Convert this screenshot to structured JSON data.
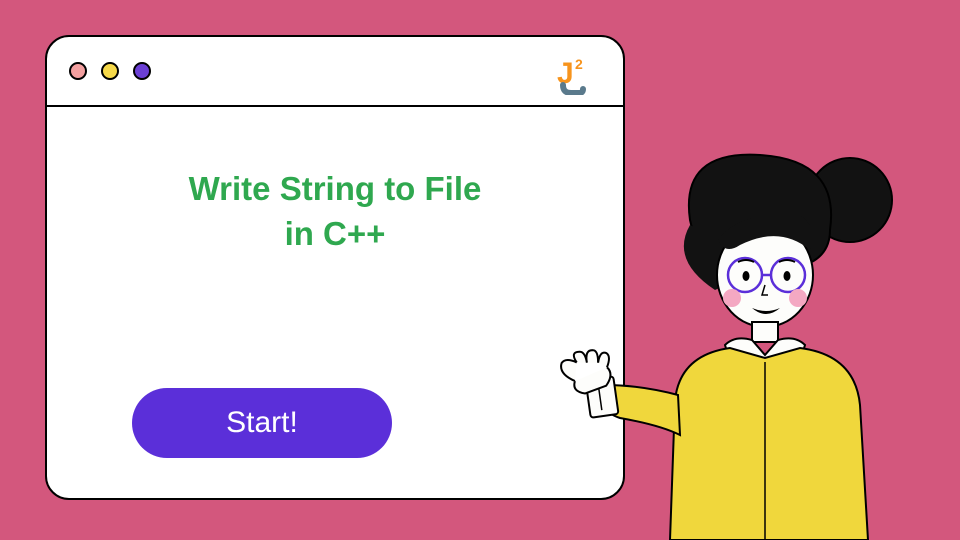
{
  "window": {
    "heading_line1": "Write String to File",
    "heading_line2": "in C++",
    "button_label": "Start!",
    "logo_text": "J",
    "logo_superscript": "2",
    "dots": [
      "red",
      "yellow",
      "purple"
    ]
  },
  "colors": {
    "background": "#d3577d",
    "window_bg": "#ffffff",
    "heading": "#2fa84f",
    "button": "#5b2fd9"
  }
}
